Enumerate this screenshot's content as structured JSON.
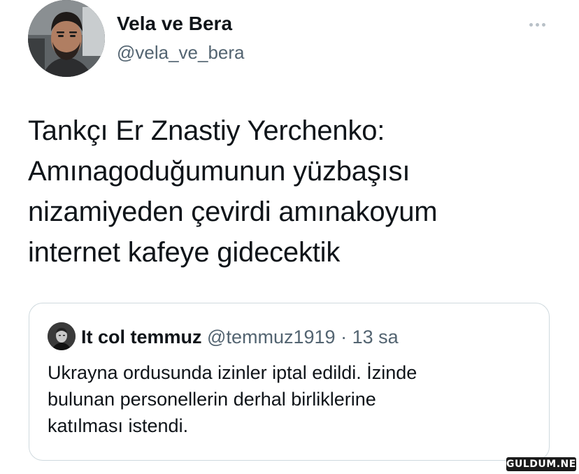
{
  "tweet": {
    "author": {
      "name": "Vela ve Bera",
      "handle": "@vela_ve_bera",
      "avatar": "avatar-photo-man"
    },
    "more_icon": "more-dots-icon",
    "text_lines": [
      "Tankçı Er Znastiy Yerchenko:",
      "Amınagoduğumunun yüzbaşısı",
      "nizamiyeden çevirdi amınakoyum",
      "internet kafeye gidecektik"
    ]
  },
  "quote": {
    "author": {
      "name": "It col temmuz",
      "handle": "@temmuz1919",
      "separator": "·",
      "time": "13 sa",
      "avatar": "avatar-photo-man-dark"
    },
    "text_lines": [
      "Ukrayna ordusunda izinler iptal edildi. İzinde",
      "bulunan personellerin derhal birliklerine",
      "katılması istendi."
    ]
  },
  "watermark": {
    "text": "GULDUM.NET"
  },
  "colors": {
    "text_primary": "#0f1419",
    "text_secondary": "#536471",
    "border": "#cfd9de",
    "background": "#ffffff"
  }
}
